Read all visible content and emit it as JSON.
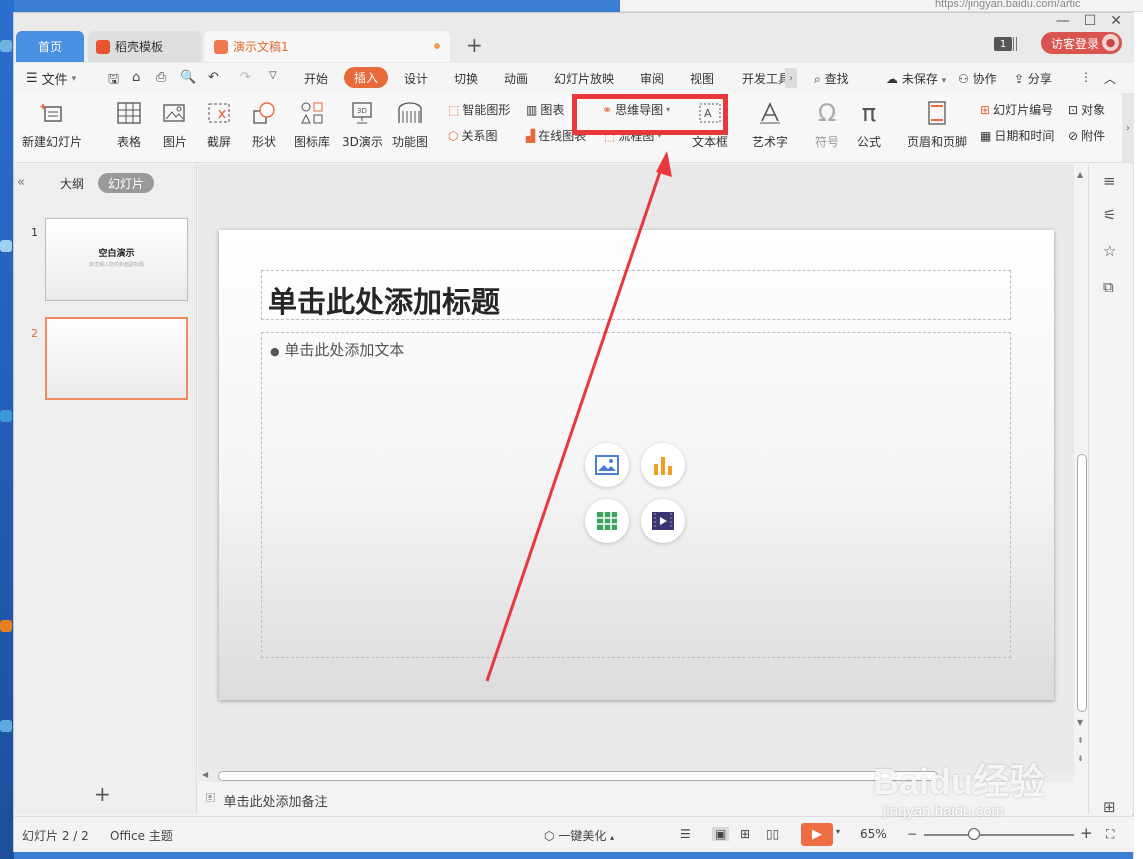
{
  "browser": {
    "url": "https://jingyan.baidu.com/artic"
  },
  "tabs": {
    "home": "首页",
    "template": "稻壳模板",
    "document": "演示文稿1",
    "badge": "1",
    "login": "访客登录"
  },
  "menu": {
    "file": "文件",
    "items": [
      "开始",
      "插入",
      "设计",
      "切换",
      "动画",
      "幻灯片放映",
      "审阅",
      "视图",
      "开发工具"
    ],
    "search": "查找",
    "unsaved": "未保存",
    "collab": "协作",
    "share": "分享"
  },
  "ribbon": {
    "new_slide": "新建幻灯片",
    "table": "表格",
    "picture": "图片",
    "screenshot": "截屏",
    "shape": "形状",
    "icon_lib": "图标库",
    "demo3d": "3D演示",
    "func_chart": "功能图",
    "smart_art": "智能图形",
    "chart": "图表",
    "mind_map": "思维导图",
    "relation": "关系图",
    "online_chart": "在线图表",
    "flowchart": "流程图",
    "textbox": "文本框",
    "wordart": "艺术字",
    "symbol": "符号",
    "formula": "公式",
    "header_footer": "页眉和页脚",
    "slide_number": "幻灯片编号",
    "object": "对象",
    "date_time": "日期和时间",
    "attachment": "附件"
  },
  "left_pane": {
    "outline": "大纲",
    "slides": "幻灯片",
    "thumb1_num": "1",
    "thumb1_title": "空白演示",
    "thumb1_sub": "单击输入您的封面副标题",
    "thumb2_num": "2"
  },
  "slide": {
    "title_placeholder": "单击此处添加标题",
    "body_placeholder": "单击此处添加文本"
  },
  "notes": {
    "placeholder": "单击此处添加备注"
  },
  "status": {
    "slide_count": "幻灯片 2 / 2",
    "theme": "Office 主题",
    "beautify": "一键美化",
    "zoom": "65%"
  },
  "watermark": {
    "brand": "Baidu经验",
    "url": "jingyan.baidu.com"
  },
  "colors": {
    "accent": "#e8693a",
    "highlight": "#e8383b",
    "home_tab": "#4a90e2"
  }
}
